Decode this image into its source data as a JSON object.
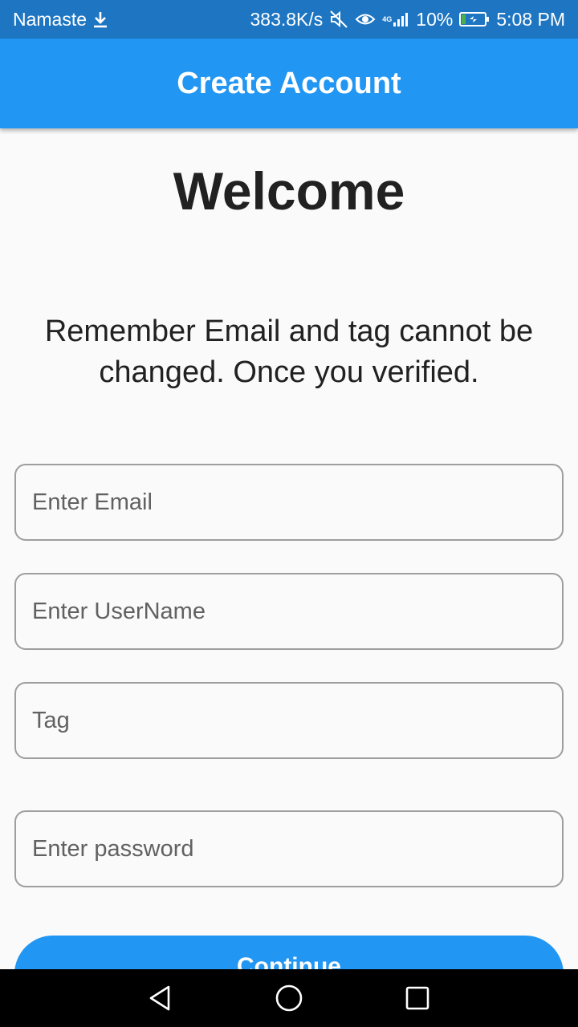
{
  "status_bar": {
    "carrier": "Namaste",
    "download_icon": "download-arrow-icon",
    "net_speed": "383.8K/s",
    "mute_icon": "mute-icon",
    "eye_icon": "eye-comfort-icon",
    "network_type": "4G",
    "signal_icon": "signal-icon",
    "battery_percent": "10%",
    "battery_icon": "battery-charging-icon",
    "time": "5:08 PM"
  },
  "app_bar": {
    "title": "Create Account",
    "color": "#2196f3"
  },
  "main": {
    "heading": "Welcome",
    "notice": "Remember Email and tag cannot be changed. Once you verified.",
    "fields": {
      "email": {
        "value": "",
        "placeholder": "Enter Email"
      },
      "username": {
        "value": "",
        "placeholder": "Enter UserName"
      },
      "tag": {
        "value": "",
        "placeholder": "Tag"
      },
      "password": {
        "value": "",
        "placeholder": "Enter password"
      }
    },
    "continue_label": "Continue"
  },
  "nav_bar": {
    "back_icon": "back-triangle-icon",
    "home_icon": "home-circle-icon",
    "recent_icon": "recent-apps-square-icon"
  },
  "colors": {
    "status_bar": "#1e76c2",
    "primary": "#2196f3",
    "background": "#fafafa",
    "border": "#9e9e9e"
  }
}
